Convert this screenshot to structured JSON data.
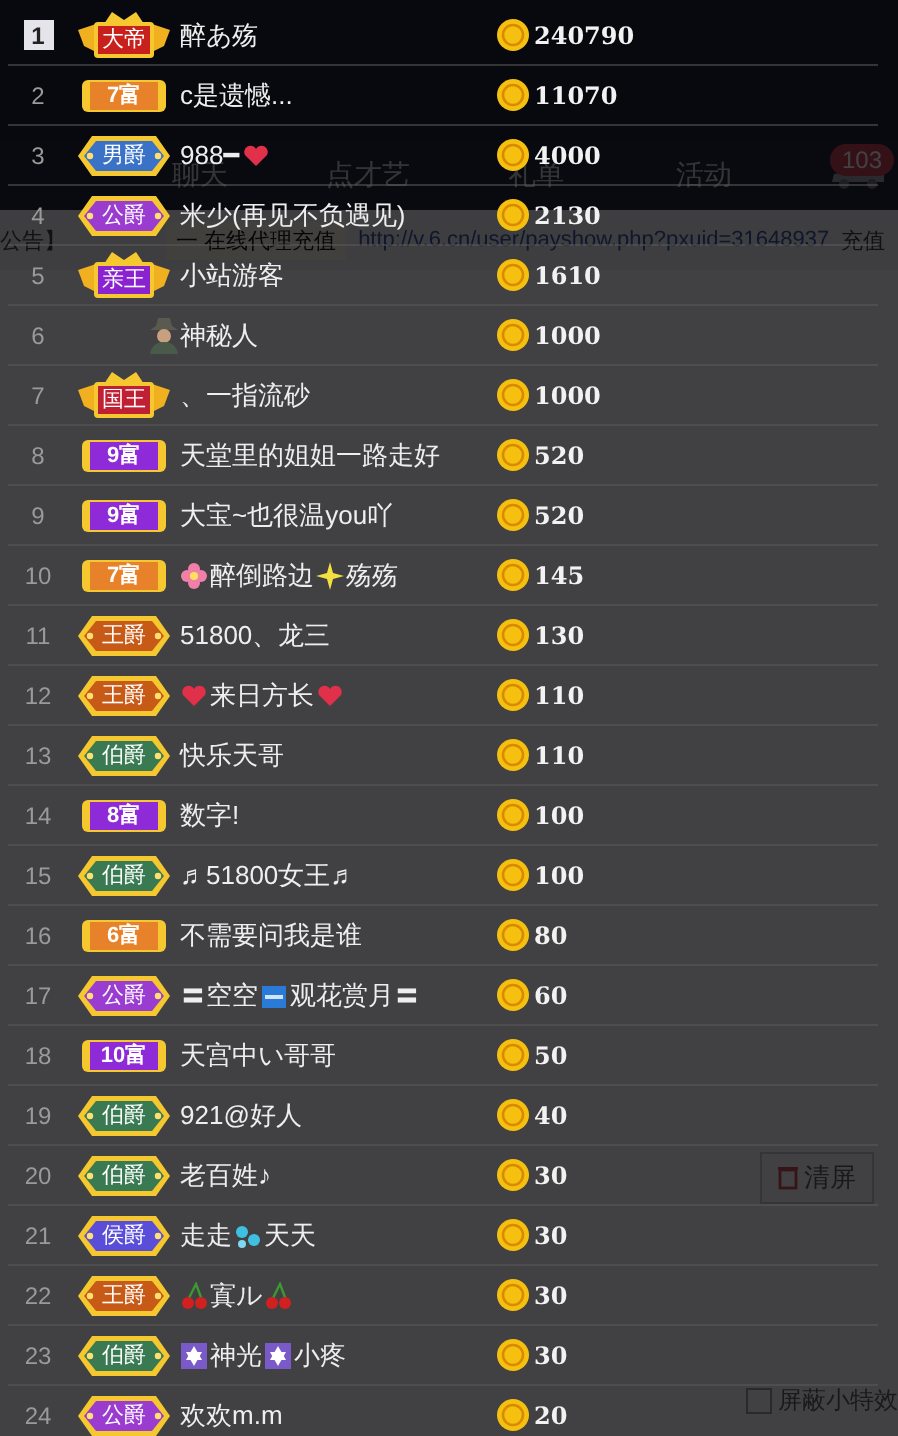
{
  "background": {
    "tabs": [
      {
        "label": "聊天"
      },
      {
        "label": "点才艺"
      },
      {
        "label": "礼单"
      },
      {
        "label": "活动"
      }
    ],
    "tab_badge": "103",
    "notice": {
      "prefix": "公告】",
      "tag": "一 在线代理充值",
      "link": "http://v.6.cn/user/payshow.php?pxuid=31648937",
      "suffix": "充值"
    },
    "clear_button": "清屏",
    "effects_checkbox": {
      "label": "屏蔽小特效",
      "checked": false
    }
  },
  "ranking": [
    {
      "rank": "1",
      "top": true,
      "badge": {
        "kind": "crown",
        "text": "大帝",
        "color": "#c8201c"
      },
      "name": [
        {
          "kind": "text",
          "text": "醉あ殇"
        }
      ],
      "amount": "240790"
    },
    {
      "rank": "2",
      "top": false,
      "badge": {
        "kind": "rich",
        "text": "7富",
        "color": "#e8822a"
      },
      "name": [
        {
          "kind": "text",
          "text": "c是遗憾..."
        }
      ],
      "amount": "11070"
    },
    {
      "rank": "3",
      "top": false,
      "badge": {
        "kind": "noble",
        "text": "男爵",
        "color": "#3a72c8"
      },
      "name": [
        {
          "kind": "text",
          "text": "988━"
        },
        {
          "kind": "heart"
        }
      ],
      "amount": "4000"
    },
    {
      "rank": "4",
      "top": false,
      "badge": {
        "kind": "noble",
        "text": "公爵",
        "color": "#9a3cd0"
      },
      "name": [
        {
          "kind": "text",
          "text": "米少(再见不负遇见)"
        }
      ],
      "amount": "2130"
    },
    {
      "rank": "5",
      "top": false,
      "badge": {
        "kind": "crown",
        "text": "亲王",
        "color": "#8a22d0"
      },
      "name": [
        {
          "kind": "text",
          "text": "小站游客"
        }
      ],
      "amount": "1610"
    },
    {
      "rank": "6",
      "top": false,
      "badge": {
        "kind": "mystery"
      },
      "name": [
        {
          "kind": "text",
          "text": "神秘人"
        }
      ],
      "amount": "1000"
    },
    {
      "rank": "7",
      "top": false,
      "badge": {
        "kind": "crown",
        "text": "国王",
        "color": "#c02034"
      },
      "name": [
        {
          "kind": "text",
          "text": "、一指流砂"
        }
      ],
      "amount": "1000"
    },
    {
      "rank": "8",
      "top": false,
      "badge": {
        "kind": "rich",
        "text": "9富",
        "color": "#8e2ad8"
      },
      "name": [
        {
          "kind": "text",
          "text": "天堂里的姐姐一路走好"
        }
      ],
      "amount": "520"
    },
    {
      "rank": "9",
      "top": false,
      "badge": {
        "kind": "rich",
        "text": "9富",
        "color": "#8e2ad8"
      },
      "name": [
        {
          "kind": "text",
          "text": "大宝~也很温you吖"
        }
      ],
      "amount": "520"
    },
    {
      "rank": "10",
      "top": false,
      "badge": {
        "kind": "rich",
        "text": "7富",
        "color": "#e8822a"
      },
      "name": [
        {
          "kind": "flower"
        },
        {
          "kind": "text",
          "text": "醉倒路边"
        },
        {
          "kind": "sparkle"
        },
        {
          "kind": "text",
          "text": "殇殇"
        }
      ],
      "amount": "145"
    },
    {
      "rank": "11",
      "top": false,
      "badge": {
        "kind": "noble",
        "text": "王爵",
        "color": "#c85a18"
      },
      "name": [
        {
          "kind": "text",
          "text": "51800、龙三"
        }
      ],
      "amount": "130"
    },
    {
      "rank": "12",
      "top": false,
      "badge": {
        "kind": "noble",
        "text": "王爵",
        "color": "#c85a18"
      },
      "name": [
        {
          "kind": "heart"
        },
        {
          "kind": "text",
          "text": "来日方长"
        },
        {
          "kind": "heart"
        }
      ],
      "amount": "110"
    },
    {
      "rank": "13",
      "top": false,
      "badge": {
        "kind": "noble",
        "text": "伯爵",
        "color": "#3a7a52"
      },
      "name": [
        {
          "kind": "text",
          "text": "快乐天哥"
        }
      ],
      "amount": "110"
    },
    {
      "rank": "14",
      "top": false,
      "badge": {
        "kind": "rich",
        "text": "8富",
        "color": "#8e2ad8"
      },
      "name": [
        {
          "kind": "text",
          "text": "数字!"
        }
      ],
      "amount": "100"
    },
    {
      "rank": "15",
      "top": false,
      "badge": {
        "kind": "noble",
        "text": "伯爵",
        "color": "#3a7a52"
      },
      "name": [
        {
          "kind": "text",
          "text": "♬51800女王♬"
        }
      ],
      "amount": "100"
    },
    {
      "rank": "16",
      "top": false,
      "badge": {
        "kind": "rich",
        "text": "6富",
        "color": "#e8822a"
      },
      "name": [
        {
          "kind": "text",
          "text": "不需要问我是谁"
        }
      ],
      "amount": "80"
    },
    {
      "rank": "17",
      "top": false,
      "badge": {
        "kind": "noble",
        "text": "公爵",
        "color": "#9a3cd0"
      },
      "name": [
        {
          "kind": "text",
          "text": "〓空空"
        },
        {
          "kind": "new"
        },
        {
          "kind": "text",
          "text": "观花赏月〓"
        }
      ],
      "amount": "60"
    },
    {
      "rank": "18",
      "top": false,
      "badge": {
        "kind": "rich",
        "text": "10富",
        "color": "#8e2ad8"
      },
      "name": [
        {
          "kind": "text",
          "text": "天宫中い哥哥"
        }
      ],
      "amount": "50"
    },
    {
      "rank": "19",
      "top": false,
      "badge": {
        "kind": "noble",
        "text": "伯爵",
        "color": "#3a7a52"
      },
      "name": [
        {
          "kind": "text",
          "text": "921@好人"
        }
      ],
      "amount": "40"
    },
    {
      "rank": "20",
      "top": false,
      "badge": {
        "kind": "noble",
        "text": "伯爵",
        "color": "#3a7a52"
      },
      "name": [
        {
          "kind": "text",
          "text": "老百姓♪"
        }
      ],
      "amount": "30"
    },
    {
      "rank": "21",
      "top": false,
      "badge": {
        "kind": "noble",
        "text": "侯爵",
        "color": "#5a4ed8"
      },
      "name": [
        {
          "kind": "text",
          "text": "走走"
        },
        {
          "kind": "drops"
        },
        {
          "kind": "text",
          "text": "天天"
        }
      ],
      "amount": "30"
    },
    {
      "rank": "22",
      "top": false,
      "badge": {
        "kind": "noble",
        "text": "王爵",
        "color": "#c85a18"
      },
      "name": [
        {
          "kind": "cherry"
        },
        {
          "kind": "text",
          "text": "寘ル"
        },
        {
          "kind": "cherry"
        }
      ],
      "amount": "30"
    },
    {
      "rank": "23",
      "top": false,
      "badge": {
        "kind": "noble",
        "text": "伯爵",
        "color": "#3a7a52"
      },
      "name": [
        {
          "kind": "hexstar"
        },
        {
          "kind": "text",
          "text": "神光"
        },
        {
          "kind": "hexstar"
        },
        {
          "kind": "text",
          "text": "小疼"
        }
      ],
      "amount": "30"
    },
    {
      "rank": "24",
      "top": false,
      "badge": {
        "kind": "noble",
        "text": "公爵",
        "color": "#9a3cd0"
      },
      "name": [
        {
          "kind": "text",
          "text": "欢欢m.m"
        }
      ],
      "amount": "20"
    }
  ]
}
